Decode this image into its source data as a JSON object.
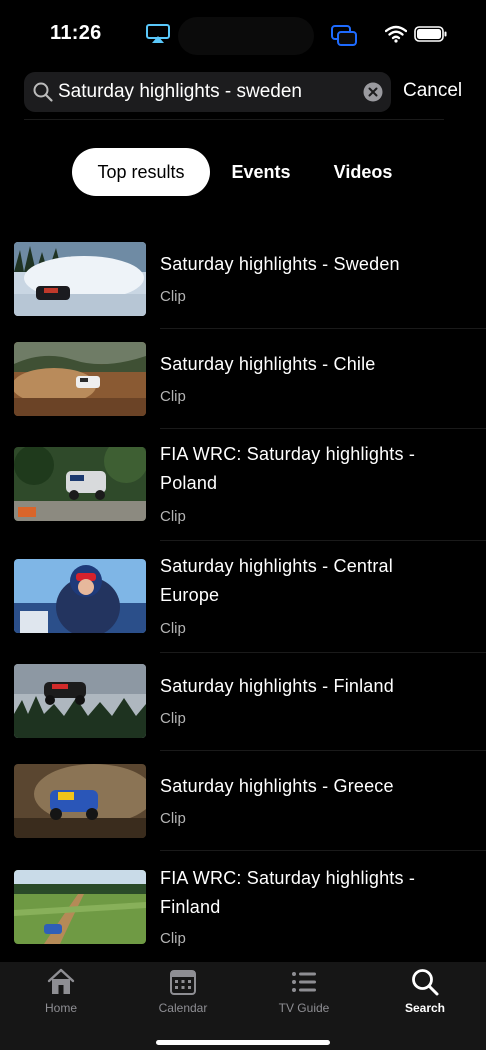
{
  "status_bar": {
    "time": "11:26"
  },
  "search": {
    "query": "Saturday highlights - sweden",
    "cancel_label": "Cancel"
  },
  "tabs": [
    {
      "label": "Top results",
      "active": true
    },
    {
      "label": "Events",
      "active": false
    },
    {
      "label": "Videos",
      "active": false
    }
  ],
  "results": [
    {
      "title": "Saturday highlights - Sweden",
      "type": "Clip"
    },
    {
      "title": "Saturday highlights - Chile",
      "type": "Clip"
    },
    {
      "title": "FIA WRC: Saturday highlights - Poland",
      "type": "Clip"
    },
    {
      "title": "Saturday highlights - Central Europe",
      "type": "Clip"
    },
    {
      "title": "Saturday highlights - Finland",
      "type": "Clip"
    },
    {
      "title": "Saturday highlights - Greece",
      "type": "Clip"
    },
    {
      "title": "FIA WRC: Saturday highlights - Finland",
      "type": "Clip"
    }
  ],
  "tab_bar": [
    {
      "label": "Home",
      "icon": "home-icon",
      "active": false
    },
    {
      "label": "Calendar",
      "icon": "calendar-icon",
      "active": false
    },
    {
      "label": "TV Guide",
      "icon": "list-icon",
      "active": false
    },
    {
      "label": "Search",
      "icon": "search-icon",
      "active": true
    }
  ],
  "colors": {
    "background": "#000000",
    "accent_airplay": "#5ac8fa",
    "tab_bar": "#161616"
  }
}
